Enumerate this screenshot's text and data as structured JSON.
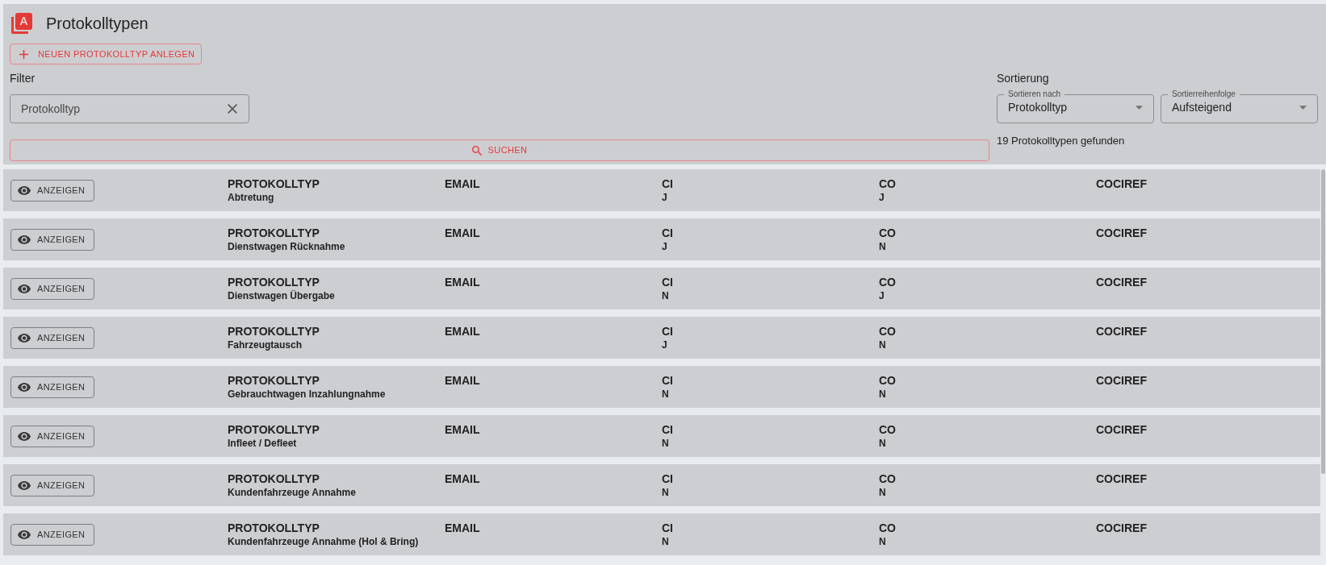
{
  "page": {
    "logo_letter": "A",
    "title": "Protokolltypen"
  },
  "create_button": {
    "label": "NEUEN PROTOKOLLTYP ANLEGEN"
  },
  "filter": {
    "heading": "Filter",
    "search_field": {
      "placeholder": "Protokolltyp"
    },
    "search_button": {
      "label": "SUCHEN"
    }
  },
  "sorting": {
    "heading": "Sortierung",
    "selects": [
      {
        "label": "Sortieren nach",
        "value": "Protokolltyp"
      },
      {
        "label": "Sortierreihenfolge",
        "value": "Aufsteigend"
      }
    ],
    "result_count": "19 Protokolltypen gefunden"
  },
  "rows": [
    {
      "button": "ANZEIGEN",
      "fields": [
        {
          "label": "PROTOKOLLTYP",
          "value": "Abtretung"
        },
        {
          "label": "EMAIL"
        },
        {
          "label": "CI",
          "value": "J"
        },
        {
          "label": "CO",
          "value": "J"
        },
        {
          "label": "COCIREF"
        }
      ]
    },
    {
      "button": "ANZEIGEN",
      "fields": [
        {
          "label": "PROTOKOLLTYP",
          "value": "Dienstwagen Rücknahme"
        },
        {
          "label": "EMAIL"
        },
        {
          "label": "CI",
          "value": "J"
        },
        {
          "label": "CO",
          "value": "N"
        },
        {
          "label": "COCIREF"
        }
      ]
    },
    {
      "button": "ANZEIGEN",
      "fields": [
        {
          "label": "PROTOKOLLTYP",
          "value": "Dienstwagen Übergabe"
        },
        {
          "label": "EMAIL"
        },
        {
          "label": "CI",
          "value": "N"
        },
        {
          "label": "CO",
          "value": "J"
        },
        {
          "label": "COCIREF"
        }
      ]
    },
    {
      "button": "ANZEIGEN",
      "fields": [
        {
          "label": "PROTOKOLLTYP",
          "value": "Fahrzeugtausch"
        },
        {
          "label": "EMAIL"
        },
        {
          "label": "CI",
          "value": "J"
        },
        {
          "label": "CO",
          "value": "N"
        },
        {
          "label": "COCIREF"
        }
      ]
    },
    {
      "button": "ANZEIGEN",
      "fields": [
        {
          "label": "PROTOKOLLTYP",
          "value": "Gebrauchtwagen Inzahlungnahme"
        },
        {
          "label": "EMAIL"
        },
        {
          "label": "CI",
          "value": "N"
        },
        {
          "label": "CO",
          "value": "N"
        },
        {
          "label": "COCIREF"
        }
      ]
    },
    {
      "button": "ANZEIGEN",
      "fields": [
        {
          "label": "PROTOKOLLTYP",
          "value": "Infleet / Defleet"
        },
        {
          "label": "EMAIL"
        },
        {
          "label": "CI",
          "value": "N"
        },
        {
          "label": "CO",
          "value": "N"
        },
        {
          "label": "COCIREF"
        }
      ]
    },
    {
      "button": "ANZEIGEN",
      "fields": [
        {
          "label": "PROTOKOLLTYP",
          "value": "Kundenfahrzeuge Annahme"
        },
        {
          "label": "EMAIL"
        },
        {
          "label": "CI",
          "value": "N"
        },
        {
          "label": "CO",
          "value": "N"
        },
        {
          "label": "COCIREF"
        }
      ]
    },
    {
      "button": "ANZEIGEN",
      "fields": [
        {
          "label": "PROTOKOLLTYP",
          "value": "Kundenfahrzeuge Annahme (Hol & Bring)"
        },
        {
          "label": "EMAIL"
        },
        {
          "label": "CI",
          "value": "N"
        },
        {
          "label": "CO",
          "value": "N"
        },
        {
          "label": "COCIREF"
        }
      ]
    }
  ]
}
